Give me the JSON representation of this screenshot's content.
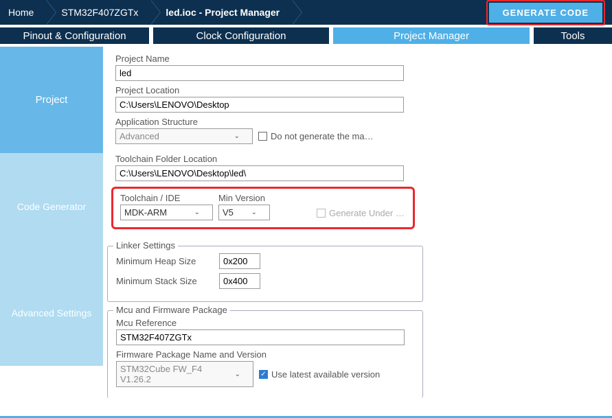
{
  "breadcrumb": {
    "home": "Home",
    "chip": "STM32F407ZGTx",
    "file": "led.ioc - Project Manager"
  },
  "generate_button": "GENERATE CODE",
  "tabs": {
    "pinout": "Pinout & Configuration",
    "clock": "Clock Configuration",
    "project": "Project Manager",
    "tools": "Tools"
  },
  "sidebar": {
    "project": "Project",
    "codegen": "Code Generator",
    "advanced": "Advanced Settings"
  },
  "form": {
    "project_name_label": "Project Name",
    "project_name_value": "led",
    "project_location_label": "Project Location",
    "project_location_value": "C:\\Users\\LENOVO\\Desktop",
    "app_structure_label": "Application Structure",
    "app_structure_value": "Advanced",
    "do_not_generate_label": "Do not generate the ma…",
    "toolchain_folder_label": "Toolchain Folder Location",
    "toolchain_folder_value": "C:\\Users\\LENOVO\\Desktop\\led\\",
    "toolchain_ide_label": "Toolchain / IDE",
    "toolchain_ide_value": "MDK-ARM",
    "min_version_label": "Min Version",
    "min_version_value": "V5",
    "generate_under_label": "Generate Under …",
    "linker_legend": "Linker Settings",
    "min_heap_label": "Minimum Heap Size",
    "min_heap_value": "0x200",
    "min_stack_label": "Minimum Stack Size",
    "min_stack_value": "0x400",
    "mcu_legend": "Mcu and Firmware Package",
    "mcu_ref_label": "Mcu Reference",
    "mcu_ref_value": "STM32F407ZGTx",
    "fw_label": "Firmware Package Name and Version",
    "fw_value": "STM32Cube FW_F4 V1.26.2",
    "use_latest_label": "Use latest available version"
  }
}
